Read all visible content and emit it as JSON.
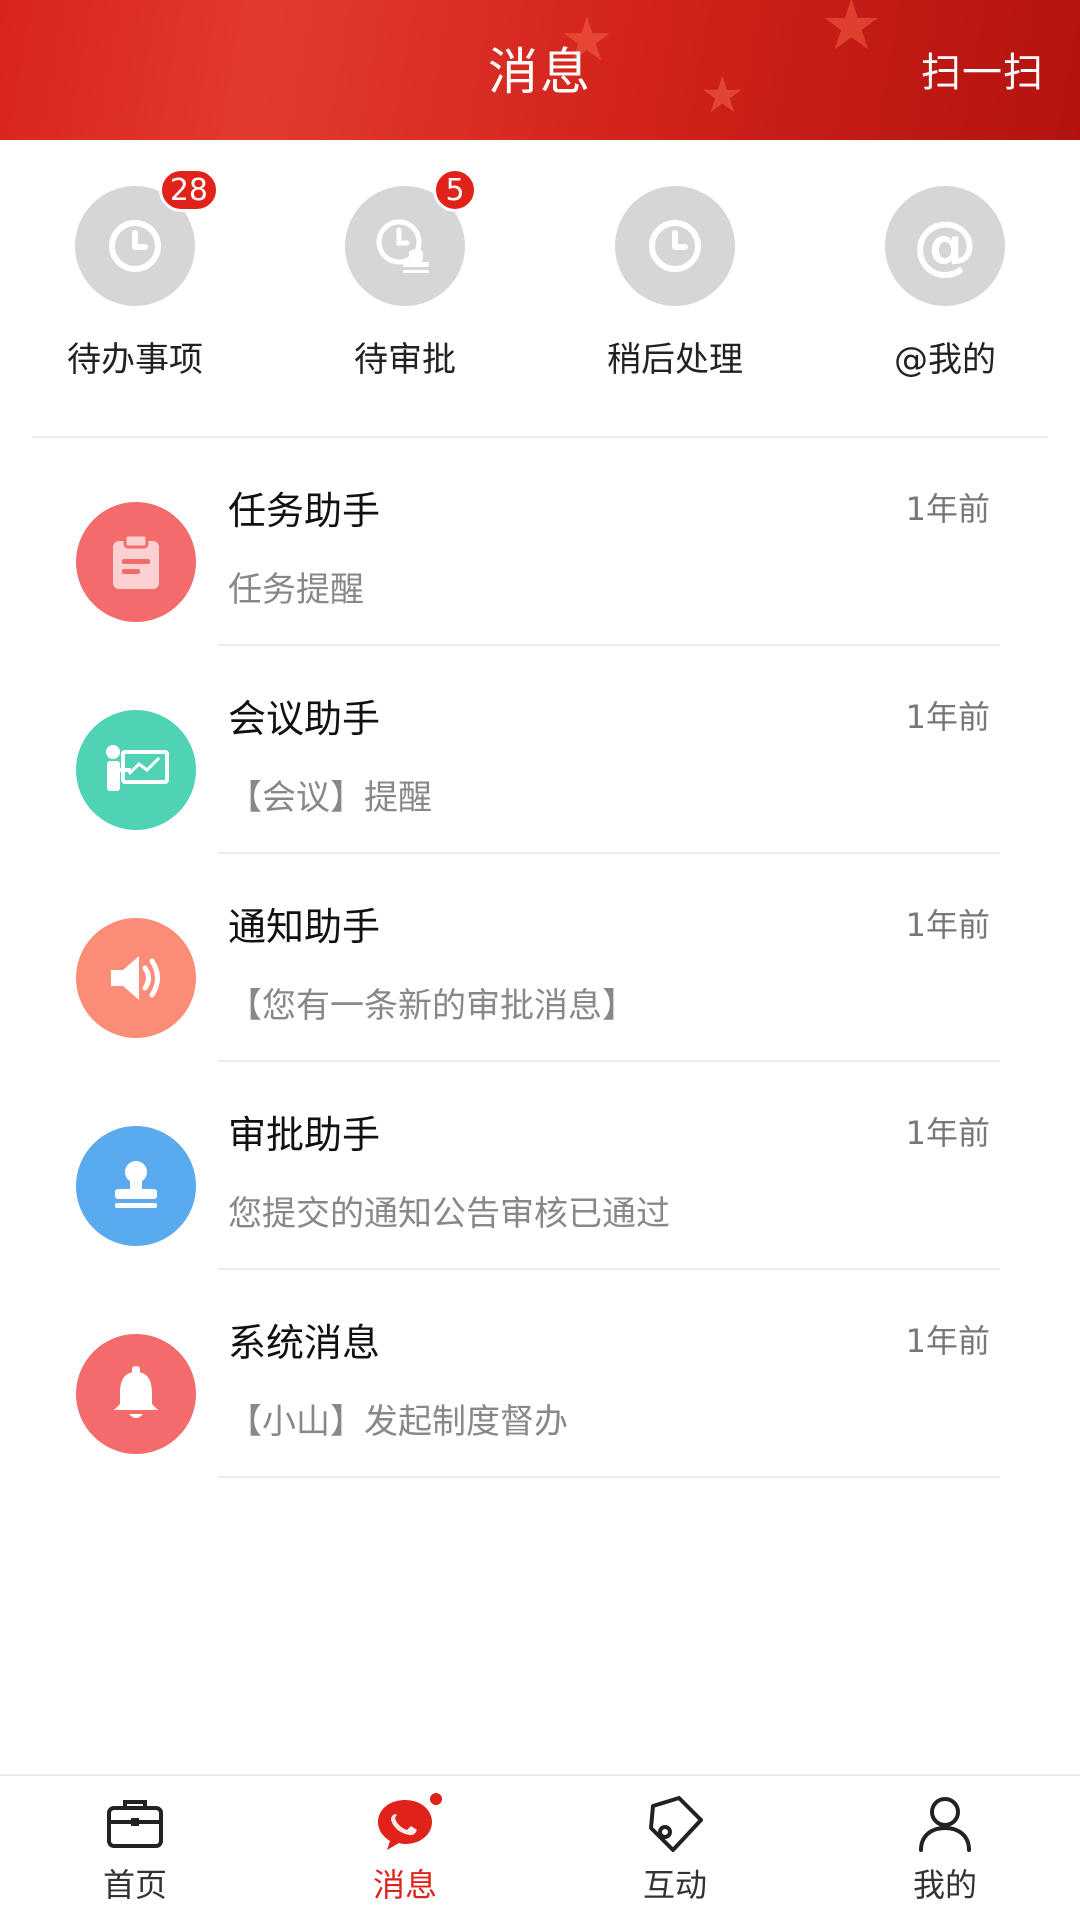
{
  "header": {
    "title": "消息",
    "scan_label": "扫一扫",
    "bg_color": "#d9241d"
  },
  "shortcuts": [
    {
      "label": "待办事项",
      "icon": "clock-icon",
      "badge": "28"
    },
    {
      "label": "待审批",
      "icon": "clock-stamp-icon",
      "badge": "5"
    },
    {
      "label": "稍后处理",
      "icon": "clock-icon",
      "badge": null
    },
    {
      "label": "@我的",
      "icon": "at-icon",
      "badge": null
    }
  ],
  "messages": [
    {
      "title": "任务助手",
      "time": "1年前",
      "preview": "任务提醒",
      "icon": "clipboard-icon",
      "color": "#f46b6b"
    },
    {
      "title": "会议助手",
      "time": "1年前",
      "preview": "【会议】提醒",
      "icon": "presentation-icon",
      "color": "#4fd3b4"
    },
    {
      "title": "通知助手",
      "time": "1年前",
      "preview": "【您有一条新的审批消息】",
      "icon": "speaker-icon",
      "color": "#fb8d78"
    },
    {
      "title": "审批助手",
      "time": "1年前",
      "preview": "您提交的通知公告审核已通过",
      "icon": "stamp-icon",
      "color": "#5aaaf0"
    },
    {
      "title": "系统消息",
      "time": "1年前",
      "preview": "【小山】发起制度督办",
      "icon": "bell-icon",
      "color": "#f46b6b"
    }
  ],
  "bottom_nav": [
    {
      "label": "首页",
      "icon": "briefcase-icon",
      "active": false
    },
    {
      "label": "消息",
      "icon": "chat-bubble-icon",
      "active": true
    },
    {
      "label": "互动",
      "icon": "tag-icon",
      "active": false
    },
    {
      "label": "我的",
      "icon": "person-icon",
      "active": false
    }
  ],
  "accent_color": "#e0221b"
}
